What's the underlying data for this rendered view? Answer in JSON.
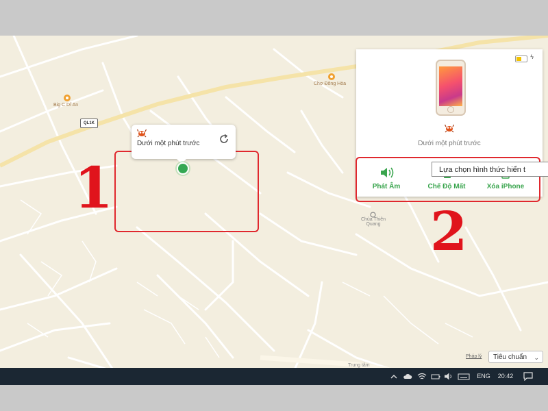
{
  "map": {
    "pois": [
      {
        "name": "Big C Dĩ An"
      },
      {
        "name": "Chợ Đông Hòa"
      },
      {
        "name": "Chùa Thiên Quang"
      },
      {
        "name": "Trung tâm"
      }
    ],
    "road_shield": "QL1K",
    "scale_link": "Pháp lý",
    "view_mode": {
      "selected": "Tiêu chuẩn"
    }
  },
  "callout": {
    "text": "Dưới một phút trước",
    "refresh_icon": "refresh-icon",
    "device_icon": "crab-icon"
  },
  "annotations": {
    "label_1": "1",
    "label_2": "2",
    "box_color": "#e0282e",
    "number_color": "#e0141c"
  },
  "device_panel": {
    "status": "Dưới một phút trước",
    "battery_icon": "battery-icon",
    "actions": [
      {
        "label": "Phát Âm",
        "icon": "speaker-icon"
      },
      {
        "label": "Chế Độ Mất",
        "icon": "lost-mode-icon"
      },
      {
        "label": "Xóa iPhone",
        "icon": "erase-icon"
      }
    ],
    "accent_color": "#3aa54e"
  },
  "tooltip": {
    "text": "Lựa chọn hình thức hiển t"
  },
  "taskbar": {
    "language": "ENG",
    "time": "20:42"
  }
}
